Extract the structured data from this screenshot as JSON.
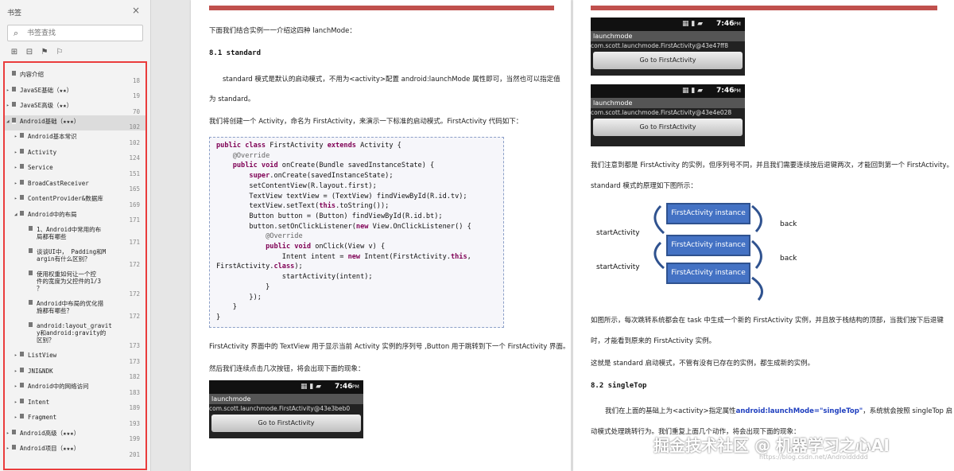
{
  "sidebar": {
    "title": "书签",
    "search_placeholder": "书签查找",
    "close": "×",
    "tools": [
      "⊞",
      "⊟",
      "⚑",
      "⚐"
    ],
    "items": [
      {
        "label": "内容介绍",
        "page": "18",
        "level": 0,
        "arrow": ""
      },
      {
        "label": "JavaSE基础（★★）",
        "page": "19",
        "level": 0,
        "arrow": "▸"
      },
      {
        "label": "JavaSE高级（★★）",
        "page": "70",
        "level": 0,
        "arrow": "▸"
      },
      {
        "label": "Android基础（★★★）",
        "page": "102",
        "level": 0,
        "arrow": "◢",
        "selected": true
      },
      {
        "label": "Android基本常识",
        "page": "102",
        "level": 1,
        "arrow": "▸"
      },
      {
        "label": "Activity",
        "page": "124",
        "level": 1,
        "arrow": "▸"
      },
      {
        "label": "Service",
        "page": "151",
        "level": 1,
        "arrow": "▸"
      },
      {
        "label": "BroadCastReceiver",
        "page": "165",
        "level": 1,
        "arrow": "▸"
      },
      {
        "label": "ContentProvider&数据库",
        "page": "169",
        "level": 1,
        "arrow": "▸"
      },
      {
        "label": "Android中的布局",
        "page": "171",
        "level": 1,
        "arrow": "◢"
      },
      {
        "label": "1、Android中常用的布\n局都有哪些",
        "page": "171",
        "level": 2,
        "arrow": ""
      },
      {
        "label": "谈谈UI中， Padding和M\nargin有什么区别？",
        "page": "172",
        "level": 2,
        "arrow": ""
      },
      {
        "label": "使用权重如何让一个控\n件的宽度为父控件的1/3\n？",
        "page": "172",
        "level": 2,
        "arrow": ""
      },
      {
        "label": "Android中布局的优化措\n施都有哪些？",
        "page": "172",
        "level": 2,
        "arrow": ""
      },
      {
        "label": "android:layout_gravit\ny和android:gravity的\n区别？",
        "page": "173",
        "level": 2,
        "arrow": ""
      },
      {
        "label": "ListView",
        "page": "173",
        "level": 1,
        "arrow": "▸"
      },
      {
        "label": "JNI&NDK",
        "page": "182",
        "level": 1,
        "arrow": "▸"
      },
      {
        "label": "Android中的网络访问",
        "page": "183",
        "level": 1,
        "arrow": "▸"
      },
      {
        "label": "Intent",
        "page": "189",
        "level": 1,
        "arrow": "▸"
      },
      {
        "label": "Fragment",
        "page": "193",
        "level": 1,
        "arrow": "▸"
      },
      {
        "label": "Android高级（★★★）",
        "page": "199",
        "level": 0,
        "arrow": "▸"
      },
      {
        "label": "Android项目（★★★）",
        "page": "201",
        "level": 0,
        "arrow": "▸"
      }
    ]
  },
  "page1": {
    "intro": "下面我们结合实例一一介绍这四种 lanchMode：",
    "h1": "8.1 standard",
    "p1a": "standard 模式是默认的启动模式，不用为<activity>配置 android:launchMode 属性即可，当然也可以指定值",
    "p1b": "为 standard。",
    "p2": "我们将创建一个 Activity，命名为 FirstActivity，来演示一下标准的启动模式。FirstActivity 代码如下：",
    "p3": "FirstActivity 界面中的 TextView 用于显示当前 Activity 实例的序列号 ,Button 用于跳转到下一个 FirstActivity 界面。",
    "p4": "然后我们连续点击几次按钮，将会出现下面的现象：",
    "phone": {
      "time": "7:46",
      "ampm": "PM",
      "title": "launchmode",
      "addr": "com.scott.launchmode.FirstActivity@43e3beb0",
      "button": "Go to FirstActivity"
    }
  },
  "page2": {
    "phone1": {
      "time": "7:46",
      "ampm": "PM",
      "title": "launchmode",
      "addr": "com.scott.launchmode.FirstActivity@43e47ff8",
      "button": "Go to FirstActivity"
    },
    "phone2": {
      "time": "7:46",
      "ampm": "PM",
      "title": "launchmode",
      "addr": "com.scott.launchmode.FirstActivity@43e4e028",
      "button": "Go to FirstActivity"
    },
    "p1": "我们注意到都是 FirstActivity 的实例，但序列号不同，并且我们需要连续按后退键两次，才能回到第一个 FirstActivity。",
    "p2": "standard 模式的原理如下图所示：",
    "diagram": {
      "inst": "FirstActivity instance",
      "start": "startActivity",
      "back": "back"
    },
    "p3a": "如图所示，每次跳转系统都会在 task 中生成一个新的 FirstActivity 实例，并且放于栈结构的顶部，当我们按下后退键",
    "p3b": "时，才能看到原来的 FirstActivity 实例。",
    "p4": "这就是 standard 启动模式，不管有没有已存在的实例，都生成新的实例。",
    "h2": "8.2 singleTop",
    "p5a": "我们在上面的基础上为<activity>指定属性",
    "p5code": "android:launchMode=\"singleTop\"",
    "p5b": "，系统就会按照 singleTop 启",
    "p6": "动模式处理跳转行为。我们重复上面几个动作，将会出现下面的现象："
  },
  "watermark": "掘金技术社区 @ 机器学习之心AI",
  "url": "https://blog.csdn.net/Androiddddd"
}
